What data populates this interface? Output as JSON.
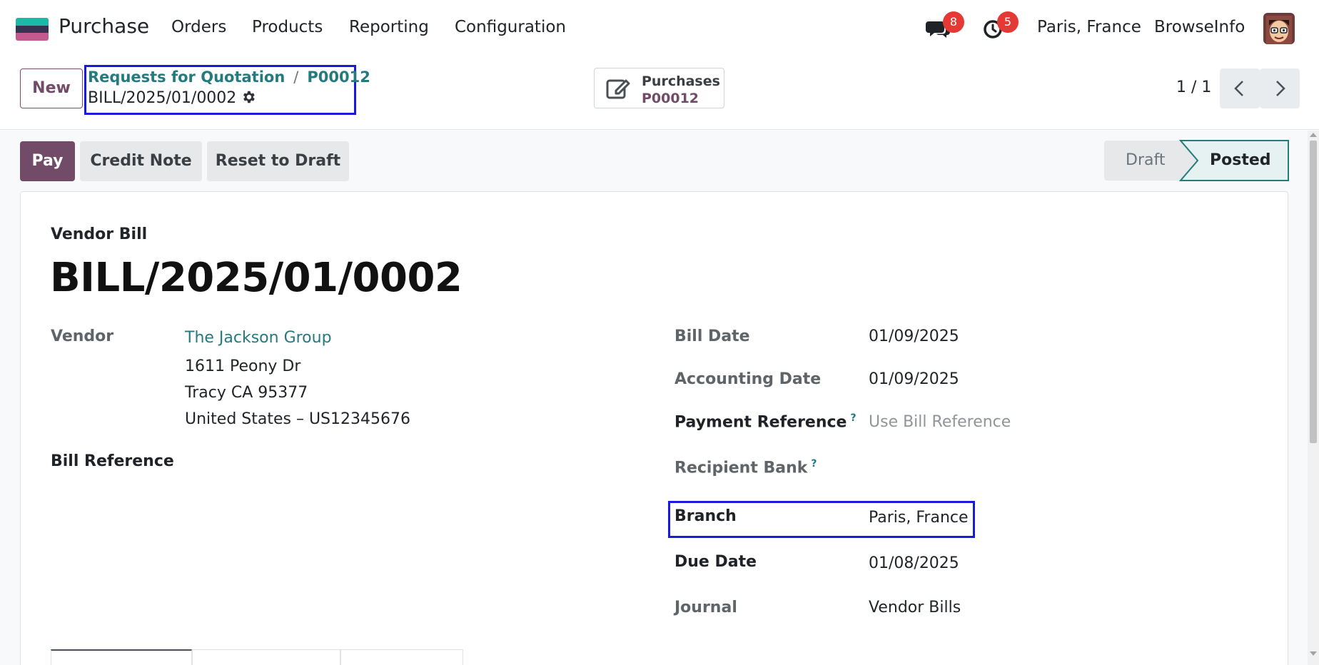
{
  "app": {
    "name": "Purchase",
    "logo_colors": [
      "#1fb8a8",
      "#35334f",
      "#c15a8f"
    ]
  },
  "menu": {
    "items": [
      "Orders",
      "Products",
      "Reporting",
      "Configuration"
    ]
  },
  "systray": {
    "messages_count": "8",
    "activities_count": "5",
    "branch": "Paris, France",
    "company": "BrowseInfo"
  },
  "control_panel": {
    "new_label": "New",
    "breadcrumb": [
      "Requests for Quotation",
      "P00012"
    ],
    "current_record": "BILL/2025/01/0002",
    "smart_button": {
      "label": "Purchases",
      "value": "P00012"
    },
    "pager": "1 / 1"
  },
  "actions": {
    "pay": "Pay",
    "credit_note": "Credit Note",
    "reset_to_draft": "Reset to Draft"
  },
  "statusbar": {
    "stages": [
      "Draft",
      "Posted"
    ],
    "active": "Posted"
  },
  "form": {
    "doc_type": "Vendor Bill",
    "doc_name": "BILL/2025/01/0002",
    "vendor_label": "Vendor",
    "vendor_name": "The Jackson Group",
    "vendor_address": [
      "1611 Peony Dr",
      "Tracy CA 95377",
      "United States – US12345676"
    ],
    "bill_reference_label": "Bill Reference",
    "bill_date_label": "Bill Date",
    "bill_date": "01/09/2025",
    "accounting_date_label": "Accounting Date",
    "accounting_date": "01/09/2025",
    "payment_reference_label": "Payment Reference",
    "payment_reference_placeholder": "Use Bill Reference",
    "recipient_bank_label": "Recipient Bank",
    "branch_label": "Branch",
    "branch": "Paris, France",
    "due_date_label": "Due Date",
    "due_date": "01/08/2025",
    "journal_label": "Journal",
    "journal": "Vendor Bills",
    "help_mark": "?"
  },
  "colors": {
    "primary": "#714b67",
    "link": "#257a7e",
    "badge": "#e53935",
    "highlight": "#1a1adb"
  }
}
